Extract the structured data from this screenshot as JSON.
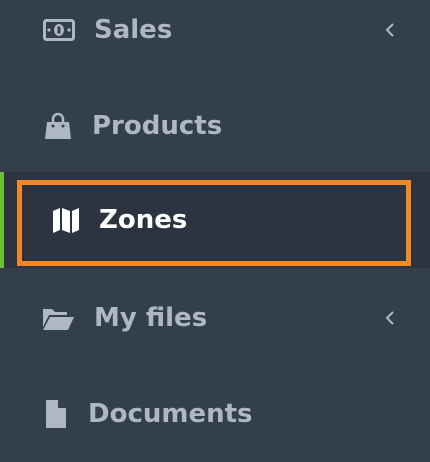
{
  "sidebar": {
    "items": [
      {
        "label": "Sales",
        "icon": "money-icon",
        "has_submenu": true
      },
      {
        "label": "Products",
        "icon": "shopping-bag-icon",
        "has_submenu": false
      },
      {
        "label": "Zones",
        "icon": "map-icon",
        "has_submenu": false,
        "active": true
      },
      {
        "label": "My files",
        "icon": "folder-open-icon",
        "has_submenu": true
      },
      {
        "label": "Documents",
        "icon": "document-icon",
        "has_submenu": false
      }
    ]
  },
  "colors": {
    "background": "#343f4d",
    "active_background": "#2b3440",
    "text": "#aeb8c4",
    "active_text": "#ffffff",
    "active_indicator": "#6fbf3f",
    "highlight_border": "#f0882a"
  }
}
